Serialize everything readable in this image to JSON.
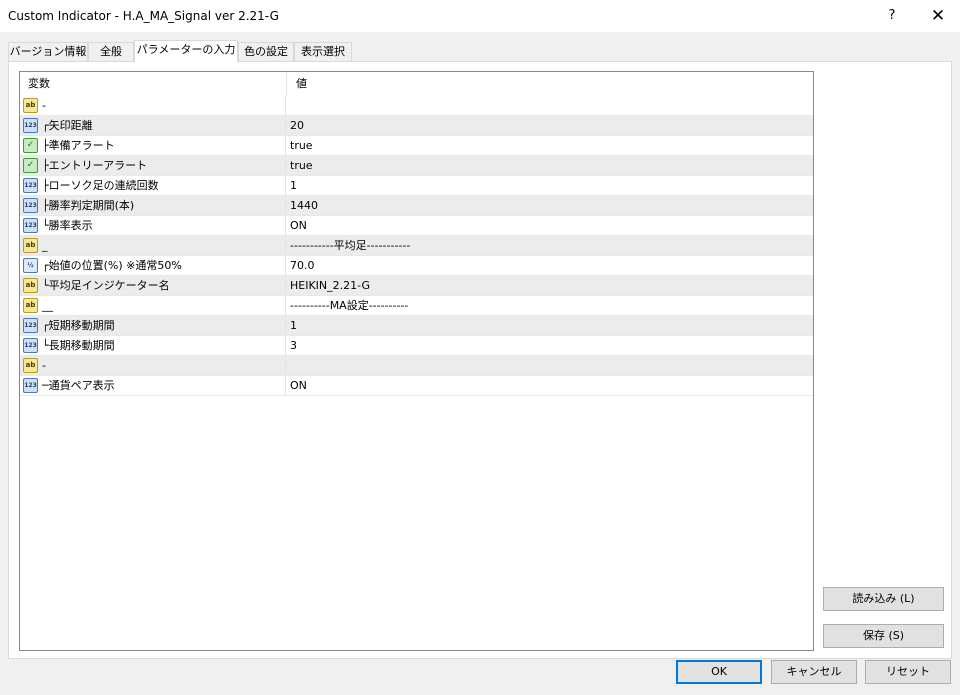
{
  "window": {
    "title": "Custom Indicator - H.A_MA_Signal ver 2.21-G",
    "help_label": "?",
    "close_label": "✕"
  },
  "tabs": [
    {
      "label": "バージョン情報"
    },
    {
      "label": "全般"
    },
    {
      "label": "パラメーターの入力"
    },
    {
      "label": "色の設定"
    },
    {
      "label": "表示選択"
    }
  ],
  "grid": {
    "col_variable": "変数",
    "col_value": "値",
    "rows": [
      {
        "icon": "ab",
        "label": "-",
        "value": ""
      },
      {
        "icon": "123",
        "label": "┌矢印距離",
        "value": "20"
      },
      {
        "icon": "bool",
        "label": "├準備アラート",
        "value": "true"
      },
      {
        "icon": "bool",
        "label": "├エントリーアラート",
        "value": "true"
      },
      {
        "icon": "123",
        "label": "├ローソク足の連続回数",
        "value": "1"
      },
      {
        "icon": "123",
        "label": "├勝率判定期間(本)",
        "value": "1440"
      },
      {
        "icon": "123",
        "label": "└勝率表示",
        "value": "ON"
      },
      {
        "icon": "ab",
        "label": "_",
        "value": "-----------平均足-----------"
      },
      {
        "icon": "dbl",
        "label": "┌始値の位置(%) ※通常50%",
        "value": "70.0"
      },
      {
        "icon": "ab",
        "label": "└平均足インジケーター名",
        "value": "HEIKIN_2.21-G"
      },
      {
        "icon": "ab",
        "label": "__",
        "value": "----------MA設定----------"
      },
      {
        "icon": "123",
        "label": "┌短期移動期間",
        "value": "1"
      },
      {
        "icon": "123",
        "label": "└長期移動期間",
        "value": "3"
      },
      {
        "icon": "ab",
        "label": "-",
        "value": ""
      },
      {
        "icon": "123",
        "label": "─通貨ペア表示",
        "value": "ON"
      }
    ]
  },
  "icons": {
    "ab": "ab",
    "123": "123",
    "bool": "✓",
    "dbl": "½"
  },
  "buttons": {
    "load": "読み込み (L)",
    "save": "保存 (S)",
    "ok": "OK",
    "cancel": "キャンセル",
    "reset": "リセット"
  }
}
